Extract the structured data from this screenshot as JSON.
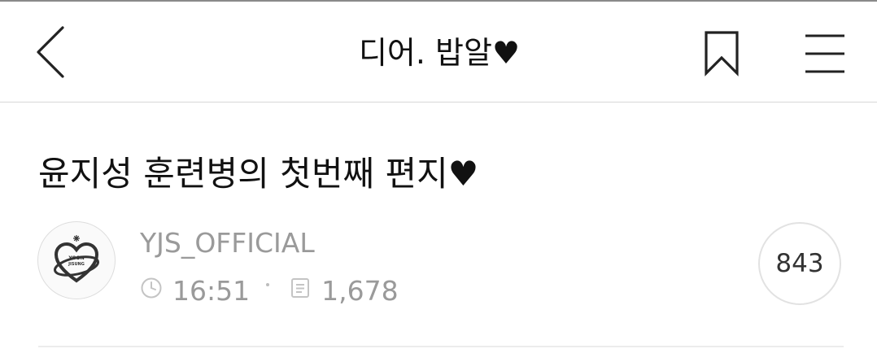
{
  "nav": {
    "back_icon": "chevron-left-icon",
    "title": "디어. 밥알♥",
    "bookmark_icon": "bookmark-icon",
    "menu_icon": "hamburger-menu-icon"
  },
  "post": {
    "title": "윤지성 훈련병의 첫번째 편지♥",
    "author": "YJS_OFFICIAL",
    "avatar_icon": "yoon-jisung-logo-avatar",
    "avatar_text_line1": "YOON",
    "avatar_text_line2": "JISUNG",
    "time_icon": "clock-icon",
    "time": "16:51",
    "views_icon": "document-icon",
    "views": "1,678",
    "comments": "843"
  },
  "colors": {
    "text_primary": "#111111",
    "text_secondary": "#9a9a9a",
    "divider": "#d8d8d8"
  }
}
